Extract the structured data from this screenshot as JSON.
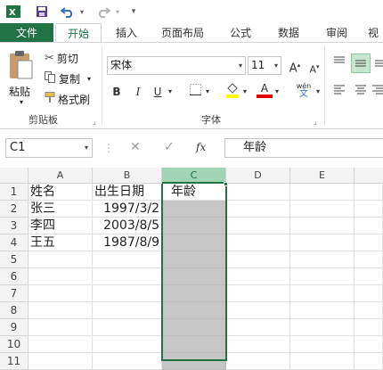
{
  "qat": {
    "excel_icon": "excel-logo-icon",
    "save_icon": "save-icon",
    "undo_icon": "undo-icon",
    "redo_icon": "redo-icon"
  },
  "tabs": [
    {
      "label": "文件"
    },
    {
      "label": "开始"
    },
    {
      "label": "插入"
    },
    {
      "label": "页面布局"
    },
    {
      "label": "公式"
    },
    {
      "label": "数据"
    },
    {
      "label": "审阅"
    },
    {
      "label": "视"
    }
  ],
  "clipboard": {
    "paste_label": "粘贴",
    "cut_label": "剪切",
    "copy_label": "复制",
    "format_painter_label": "格式刷",
    "group_label": "剪贴板"
  },
  "font": {
    "name": "宋体",
    "size": "11",
    "grow": "A",
    "shrink": "A",
    "bold": "B",
    "italic": "I",
    "underline": "U",
    "color_letter": "A",
    "phonetic": "wén",
    "group_label": "字体"
  },
  "formula_bar": {
    "name_box": "C1",
    "fx_label": "fx",
    "content": "年龄"
  },
  "grid": {
    "columns": [
      "A",
      "B",
      "C",
      "D",
      "E"
    ],
    "rows": [
      "1",
      "2",
      "3",
      "4",
      "5",
      "6",
      "7",
      "8",
      "9",
      "10",
      "11"
    ],
    "cells": [
      [
        "姓名",
        "出生日期",
        "年龄"
      ],
      [
        "张三",
        "1997/3/2",
        ""
      ],
      [
        "李四",
        "2003/8/5",
        ""
      ],
      [
        "王五",
        "1987/8/9",
        ""
      ]
    ]
  },
  "colors": {
    "accent": "#217346",
    "selected_fill": "#c6c6c6",
    "selected_header": "#a0d4b4"
  }
}
